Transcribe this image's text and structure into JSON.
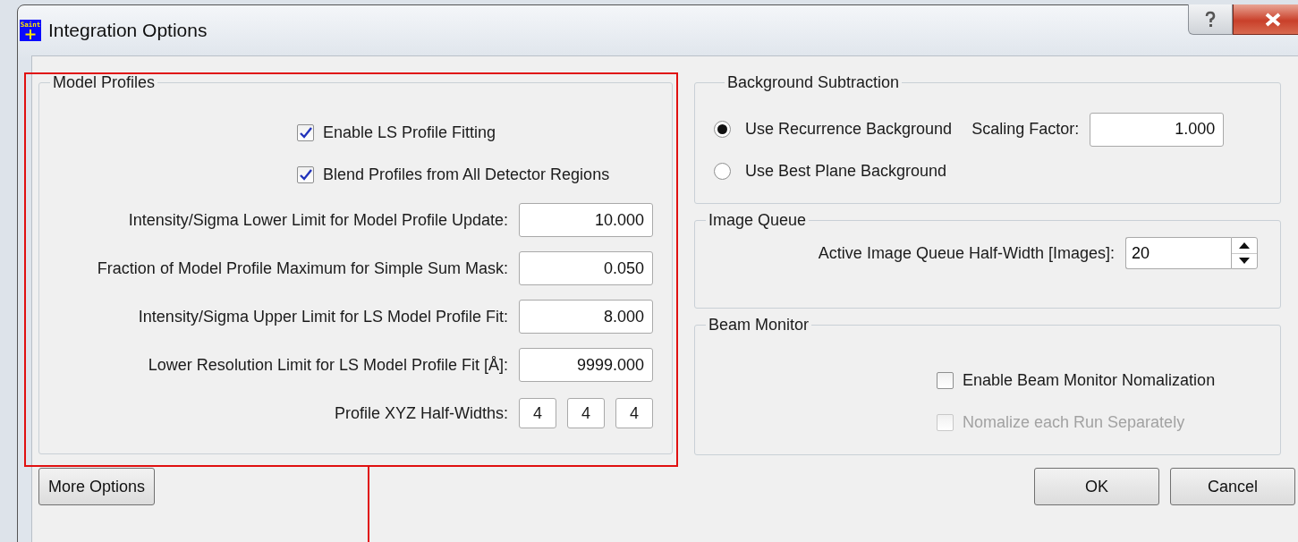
{
  "window": {
    "title": "Integration Options",
    "logo_text": "Saint"
  },
  "model_profiles": {
    "title": "Model Profiles",
    "checkboxes": [
      {
        "label": "Enable LS Profile Fitting",
        "checked": true
      },
      {
        "label": "Blend Profiles from All Detector Regions",
        "checked": true
      }
    ],
    "fields": [
      {
        "label": "Intensity/Sigma Lower Limit for Model Profile Update:",
        "value": "10.000"
      },
      {
        "label": "Fraction of Model Profile Maximum for Simple Sum Mask:",
        "value": "0.050"
      },
      {
        "label": "Intensity/Sigma Upper Limit for LS Model Profile Fit:",
        "value": "8.000"
      },
      {
        "label": "Lower Resolution Limit for LS Model Profile Fit [Å]:",
        "value": "9999.000"
      }
    ],
    "half_widths": {
      "label": "Profile XYZ Half-Widths:",
      "values": [
        "4",
        "4",
        "4"
      ]
    }
  },
  "background_subtraction": {
    "title": "Background Subtraction",
    "options": [
      {
        "label": "Use Recurrence Background",
        "selected": true
      },
      {
        "label": "Use Best Plane Background",
        "selected": false
      }
    ],
    "scaling_factor": {
      "label": "Scaling Factor:",
      "value": "1.000"
    }
  },
  "image_queue": {
    "title": "Image Queue",
    "half_width": {
      "label": "Active Image Queue Half-Width [Images]:",
      "value": "20"
    }
  },
  "beam_monitor": {
    "title": "Beam Monitor",
    "checkboxes": [
      {
        "label": "Enable Beam Monitor Nomalization",
        "checked": false,
        "disabled": false
      },
      {
        "label": "Nomalize each Run Separately",
        "checked": false,
        "disabled": true
      }
    ]
  },
  "buttons": [
    {
      "label": "More Options",
      "kind": "left"
    },
    {
      "label": "OK",
      "kind": "right"
    },
    {
      "label": "Cancel",
      "kind": "right"
    }
  ]
}
